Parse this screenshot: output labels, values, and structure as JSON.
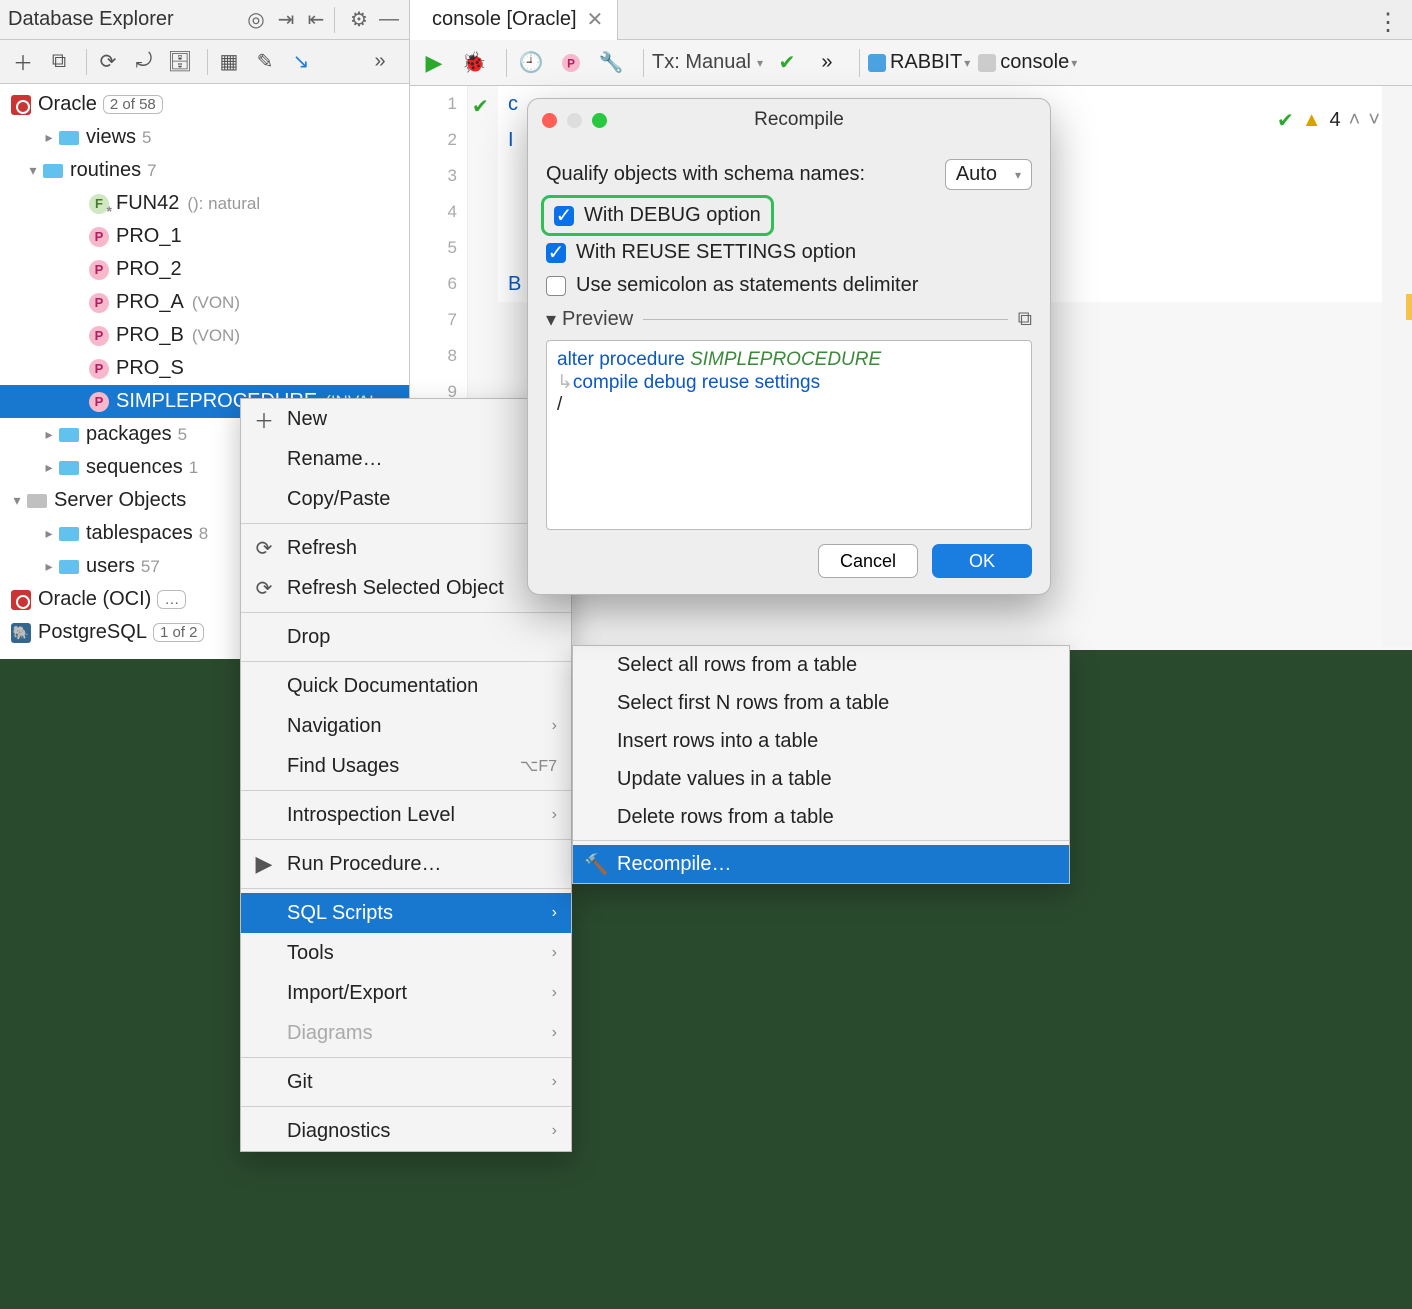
{
  "panel": {
    "title": "Database Explorer"
  },
  "tree": {
    "oracle": {
      "name": "Oracle",
      "filter": "2 of 58"
    },
    "views": {
      "name": "views",
      "count": "5"
    },
    "routines": {
      "name": "routines",
      "count": "7"
    },
    "fun42": {
      "name": "FUN42",
      "sig": "(): natural"
    },
    "pro1": {
      "name": "PRO_1"
    },
    "pro2": {
      "name": "PRO_2"
    },
    "proA": {
      "name": "PRO_A",
      "note": "(VON)"
    },
    "proB": {
      "name": "PRO_B",
      "note": "(VON)"
    },
    "proS": {
      "name": "PRO_S"
    },
    "simple": {
      "name": "SIMPLEPROCEDURE",
      "note": "(INVAL"
    },
    "packages": {
      "name": "packages",
      "count": "5"
    },
    "sequences": {
      "name": "sequences",
      "count": "1"
    },
    "serverObjects": {
      "name": "Server Objects"
    },
    "tablespaces": {
      "name": "tablespaces",
      "count": "8"
    },
    "users": {
      "name": "users",
      "count": "57"
    },
    "oracleOci": {
      "name": "Oracle (OCI)"
    },
    "postgres": {
      "name": "PostgreSQL",
      "filter": "1 of 2"
    }
  },
  "tab": {
    "label": "console [Oracle]"
  },
  "edToolbar": {
    "tx": "Tx: Manual",
    "ds": "RABBIT",
    "console": "console"
  },
  "gutter": [
    "1",
    "2",
    "3",
    "4",
    "5",
    "6",
    "7",
    "8",
    "9"
  ],
  "codeVisible": {
    "l1": "c",
    "l2": "I",
    "l6": "B"
  },
  "warnChip": "4",
  "ctx": {
    "new": "New",
    "rename": "Rename…",
    "copy": "Copy/Paste",
    "refresh": "Refresh",
    "refreshSel": "Refresh Selected Object",
    "drop": "Drop",
    "qdoc": "Quick Documentation",
    "nav": "Navigation",
    "find": "Find Usages",
    "findSc": "⌥F7",
    "introspect": "Introspection Level",
    "run": "Run Procedure…",
    "sql": "SQL Scripts",
    "tools": "Tools",
    "impexp": "Import/Export",
    "diag": "Diagrams",
    "git": "Git",
    "diagnostics": "Diagnostics"
  },
  "sub": {
    "selAll": "Select all rows from a table",
    "selN": "Select first N rows from a table",
    "ins": "Insert rows into a table",
    "upd": "Update values in a table",
    "del": "Delete rows from a table",
    "recompile": "Recompile…"
  },
  "dlg": {
    "title": "Recompile",
    "qualify": "Qualify objects with schema names:",
    "qualifyOpt": "Auto",
    "withDebug": "With DEBUG option",
    "withReuse": "With REUSE SETTINGS option",
    "useSemi": "Use semicolon as statements delimiter",
    "preview": "Preview",
    "code1a": "alter procedure ",
    "code1b": "SIMPLEPROCEDURE",
    "code2": "compile debug reuse settings",
    "code3": "/",
    "cancel": "Cancel",
    "ok": "OK"
  }
}
